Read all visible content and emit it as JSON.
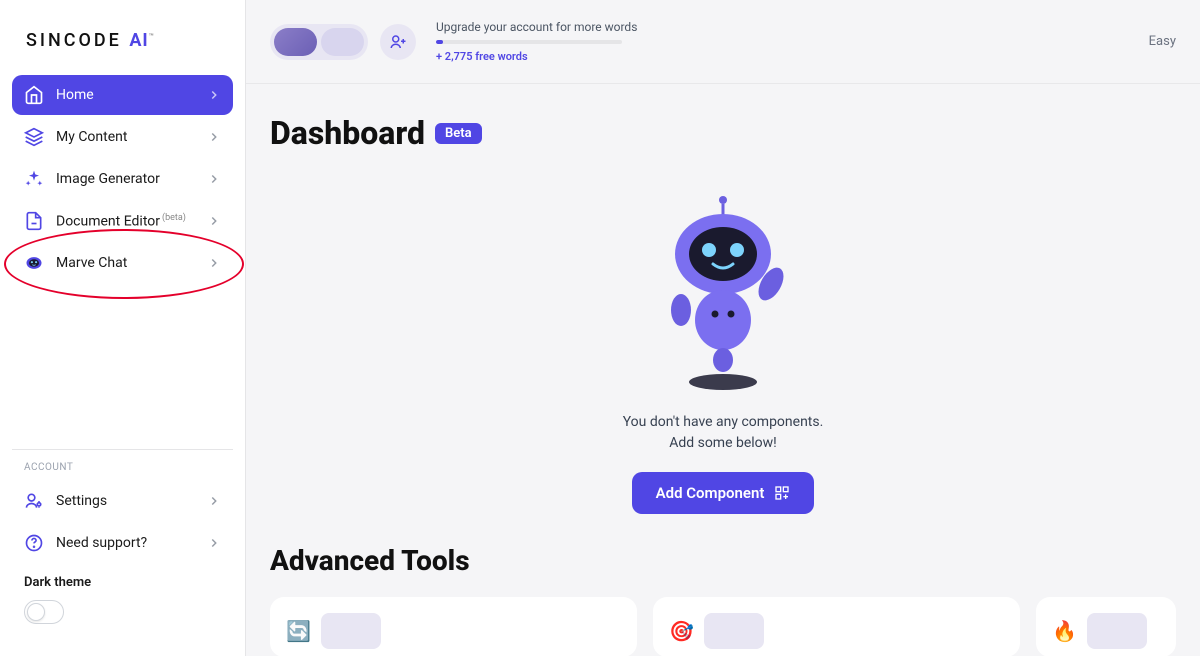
{
  "logo": {
    "text": "SINCODE",
    "accent": "AI",
    "tm": "™"
  },
  "sidebar": {
    "items": [
      {
        "label": "Home",
        "active": true
      },
      {
        "label": "My Content"
      },
      {
        "label": "Image Generator"
      },
      {
        "label": "Document Editor",
        "sup": "(beta)"
      },
      {
        "label": "Marve Chat",
        "highlighted": true
      }
    ],
    "account_label": "ACCOUNT",
    "account_items": [
      {
        "label": "Settings"
      },
      {
        "label": "Need support?"
      }
    ],
    "dark_theme_label": "Dark theme"
  },
  "topbar": {
    "upgrade_text": "Upgrade your account for more words",
    "free_words": "+ 2,775 free words",
    "easy": "Easy"
  },
  "dashboard": {
    "title": "Dashboard",
    "badge": "Beta",
    "empty_line1": "You don't have any components.",
    "empty_line2": "Add some below!",
    "add_button": "Add Component"
  },
  "advanced": {
    "title": "Advanced Tools"
  }
}
